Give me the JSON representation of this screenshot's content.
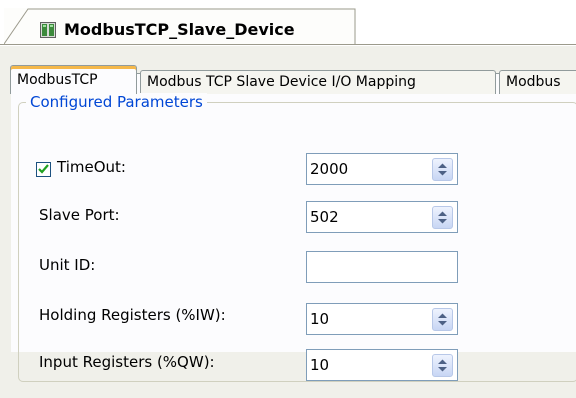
{
  "document_tab": {
    "title": "ModbusTCP_Slave_Device",
    "icon": "device-icon"
  },
  "tabs": [
    {
      "label": "ModbusTCP",
      "active": true
    },
    {
      "label": "Modbus TCP Slave Device I/O Mapping",
      "active": false
    },
    {
      "label": "Modbus",
      "active": false
    }
  ],
  "group": {
    "title": "Configured Parameters"
  },
  "fields": {
    "timeout": {
      "label": "TimeOut:",
      "value": "2000",
      "checked": true
    },
    "slave_port": {
      "label": "Slave Port:",
      "value": "502"
    },
    "unit_id": {
      "label": "Unit ID:",
      "value": ""
    },
    "holding_registers": {
      "label": "Holding Registers (%IW):",
      "value": "10"
    },
    "input_registers": {
      "label": "Input Registers (%QW):",
      "value": "10"
    }
  },
  "colors": {
    "accent": "#f5b84a",
    "group_title": "#0046d5",
    "check": "#21a121"
  }
}
